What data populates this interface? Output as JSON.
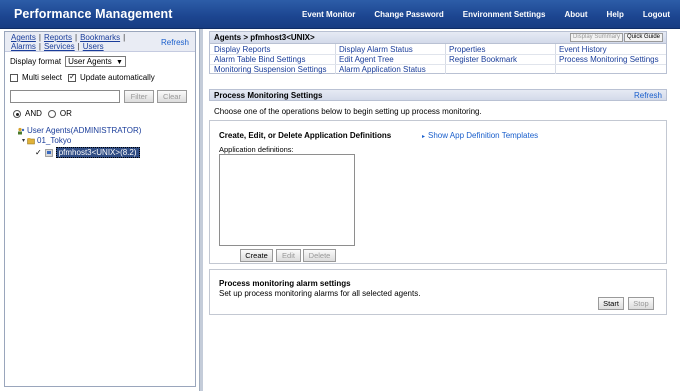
{
  "app": {
    "title": "Performance Management",
    "nav": [
      "Event Monitor",
      "Change Password",
      "Environment Settings",
      "About",
      "Help",
      "Logout"
    ]
  },
  "left": {
    "tabs_row1": [
      "Agents",
      "Reports",
      "Bookmarks"
    ],
    "tabs_row2": [
      "Alarms",
      "Services",
      "Users"
    ],
    "refresh": "Refresh",
    "display_format_label": "Display format",
    "display_format_value": "User Agents",
    "multi_select": "Multi select",
    "update_auto": "Update automatically",
    "filter_button": "Filter",
    "clear_button": "Clear",
    "and_label": "AND",
    "or_label": "OR",
    "tree": {
      "root": "User Agents(ADMINISTRATOR)",
      "group": "01_Tokyo",
      "agent": "pfmhost3<UNIX>(8.2)"
    }
  },
  "agents_panel": {
    "breadcrumb": "Agents > pfmhost3<UNIX>",
    "display_summary": "Display Summary",
    "quick_guide": "Quick Guide",
    "menu": [
      [
        "Display Reports",
        "Display Alarm Status",
        "Properties",
        "Event History"
      ],
      [
        "Alarm Table Bind Settings",
        "Edit Agent Tree",
        "Register Bookmark",
        "Process Monitoring Settings"
      ],
      [
        "Monitoring Suspension Settings",
        "Alarm Application Status",
        "",
        ""
      ]
    ]
  },
  "pm": {
    "header": "Process Monitoring Settings",
    "refresh": "Refresh",
    "description": "Choose one of the operations below to begin setting up process monitoring.",
    "app_def_title": "Create, Edit, or Delete Application Definitions",
    "show_templates": "Show App Definition Templates",
    "app_defs_label": "Application definitions:",
    "create": "Create",
    "edit": "Edit",
    "delete": "Delete",
    "alarm_title": "Process monitoring alarm settings",
    "alarm_desc": "Set up process monitoring alarms for all selected agents.",
    "start": "Start",
    "stop": "Stop"
  }
}
